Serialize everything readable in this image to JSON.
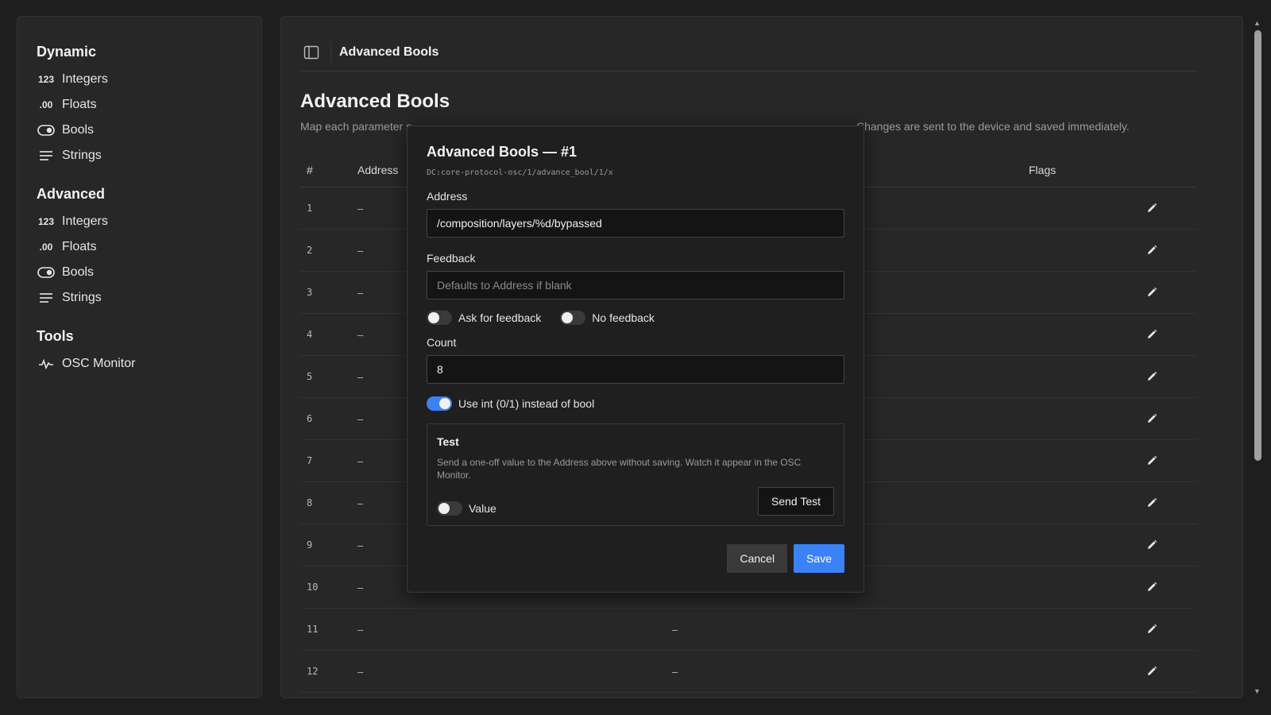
{
  "sidebar": {
    "sections": [
      {
        "title": "Dynamic",
        "items": [
          {
            "icon": "123",
            "label": "Integers"
          },
          {
            "icon": ".00",
            "label": "Floats"
          },
          {
            "icon": "toggle",
            "label": "Bools"
          },
          {
            "icon": "lines",
            "label": "Strings"
          }
        ]
      },
      {
        "title": "Advanced",
        "items": [
          {
            "icon": "123",
            "label": "Integers"
          },
          {
            "icon": ".00",
            "label": "Floats"
          },
          {
            "icon": "toggle",
            "label": "Bools"
          },
          {
            "icon": "lines",
            "label": "Strings"
          }
        ]
      },
      {
        "title": "Tools",
        "items": [
          {
            "icon": "pulse",
            "label": "OSC Monitor"
          }
        ]
      }
    ]
  },
  "topbar": {
    "title": "Advanced Bools"
  },
  "page": {
    "title": "Advanced Bools",
    "description": "Map each parameter s",
    "description_end": "Changes are sent to the device and saved immediately."
  },
  "table": {
    "headers": {
      "num": "#",
      "address": "Address",
      "feedback": "",
      "flags": "Flags"
    },
    "rows": [
      {
        "num": "1",
        "address": "–",
        "feedback": ""
      },
      {
        "num": "2",
        "address": "–",
        "feedback": ""
      },
      {
        "num": "3",
        "address": "–",
        "feedback": ""
      },
      {
        "num": "4",
        "address": "–",
        "feedback": ""
      },
      {
        "num": "5",
        "address": "–",
        "feedback": ""
      },
      {
        "num": "6",
        "address": "–",
        "feedback": ""
      },
      {
        "num": "7",
        "address": "–",
        "feedback": ""
      },
      {
        "num": "8",
        "address": "–",
        "feedback": ""
      },
      {
        "num": "9",
        "address": "–",
        "feedback": ""
      },
      {
        "num": "10",
        "address": "–",
        "feedback": ""
      },
      {
        "num": "11",
        "address": "–",
        "feedback": "–"
      },
      {
        "num": "12",
        "address": "–",
        "feedback": "–"
      }
    ]
  },
  "modal": {
    "title": "Advanced Bools — #1",
    "path": "DC:core-protocol-osc/1/advance_bool/1/x",
    "address_label": "Address",
    "address_value": "/composition/layers/%d/bypassed",
    "feedback_label": "Feedback",
    "feedback_placeholder": "Defaults to Address if blank",
    "ask_feedback_label": "Ask for feedback",
    "no_feedback_label": "No feedback",
    "count_label": "Count",
    "count_value": "8",
    "use_int_label": "Use int (0/1) instead of bool",
    "test": {
      "title": "Test",
      "description": "Send a one-off value to the Address above without saving. Watch it appear in the OSC Monitor.",
      "value_label": "Value",
      "send_label": "Send Test"
    },
    "cancel_label": "Cancel",
    "save_label": "Save"
  },
  "colors": {
    "accent": "#3b82f6",
    "background": "#1e1e1e",
    "panel": "#272727"
  }
}
